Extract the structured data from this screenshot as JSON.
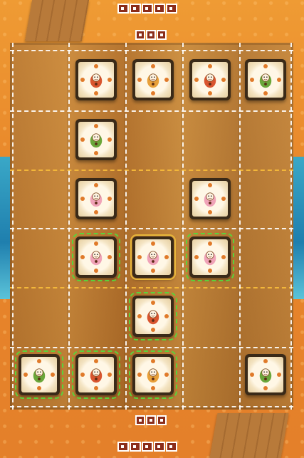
{
  "game": {
    "opponent_score_pips": 5,
    "opponent_reserve_pips": 3,
    "player_reserve_pips": 3,
    "player_score_pips": 5
  },
  "tiles": [
    {
      "id": "r1c1",
      "type": "dancer",
      "tint": "red"
    },
    {
      "id": "r1c2",
      "type": "monk",
      "tint": "orange"
    },
    {
      "id": "r1c3",
      "type": "dancer",
      "tint": "red"
    },
    {
      "id": "r1c4",
      "type": "warrior",
      "tint": "green"
    },
    {
      "id": "r2c1",
      "type": "warrior",
      "tint": "green"
    },
    {
      "id": "r3c1",
      "type": "fairy",
      "tint": "pink"
    },
    {
      "id": "r3c3",
      "type": "fairy",
      "tint": "pink"
    },
    {
      "id": "r4c1",
      "type": "fairy",
      "tint": "pink",
      "highlight": "green"
    },
    {
      "id": "r4c2",
      "type": "fairy",
      "tint": "pink",
      "highlight": "gold"
    },
    {
      "id": "r4c3",
      "type": "fairy",
      "tint": "pink",
      "highlight": "green"
    },
    {
      "id": "r5c2",
      "type": "dancer",
      "tint": "red",
      "highlight": "green"
    },
    {
      "id": "r6c0",
      "type": "warrior",
      "tint": "green",
      "highlight": "green"
    },
    {
      "id": "r6c1",
      "type": "dancer",
      "tint": "red",
      "highlight": "green"
    },
    {
      "id": "r6c2",
      "type": "monk",
      "tint": "orange",
      "highlight": "green"
    },
    {
      "id": "r6c4",
      "type": "warrior",
      "tint": "green"
    }
  ],
  "colors": {
    "sand": "#e98a2a",
    "wood": "#c9873a",
    "sea": "#1f7fae",
    "highlight_green": "#5bd23a",
    "highlight_gold": "#e7b63a",
    "pip_red": "#8b2d1a"
  }
}
